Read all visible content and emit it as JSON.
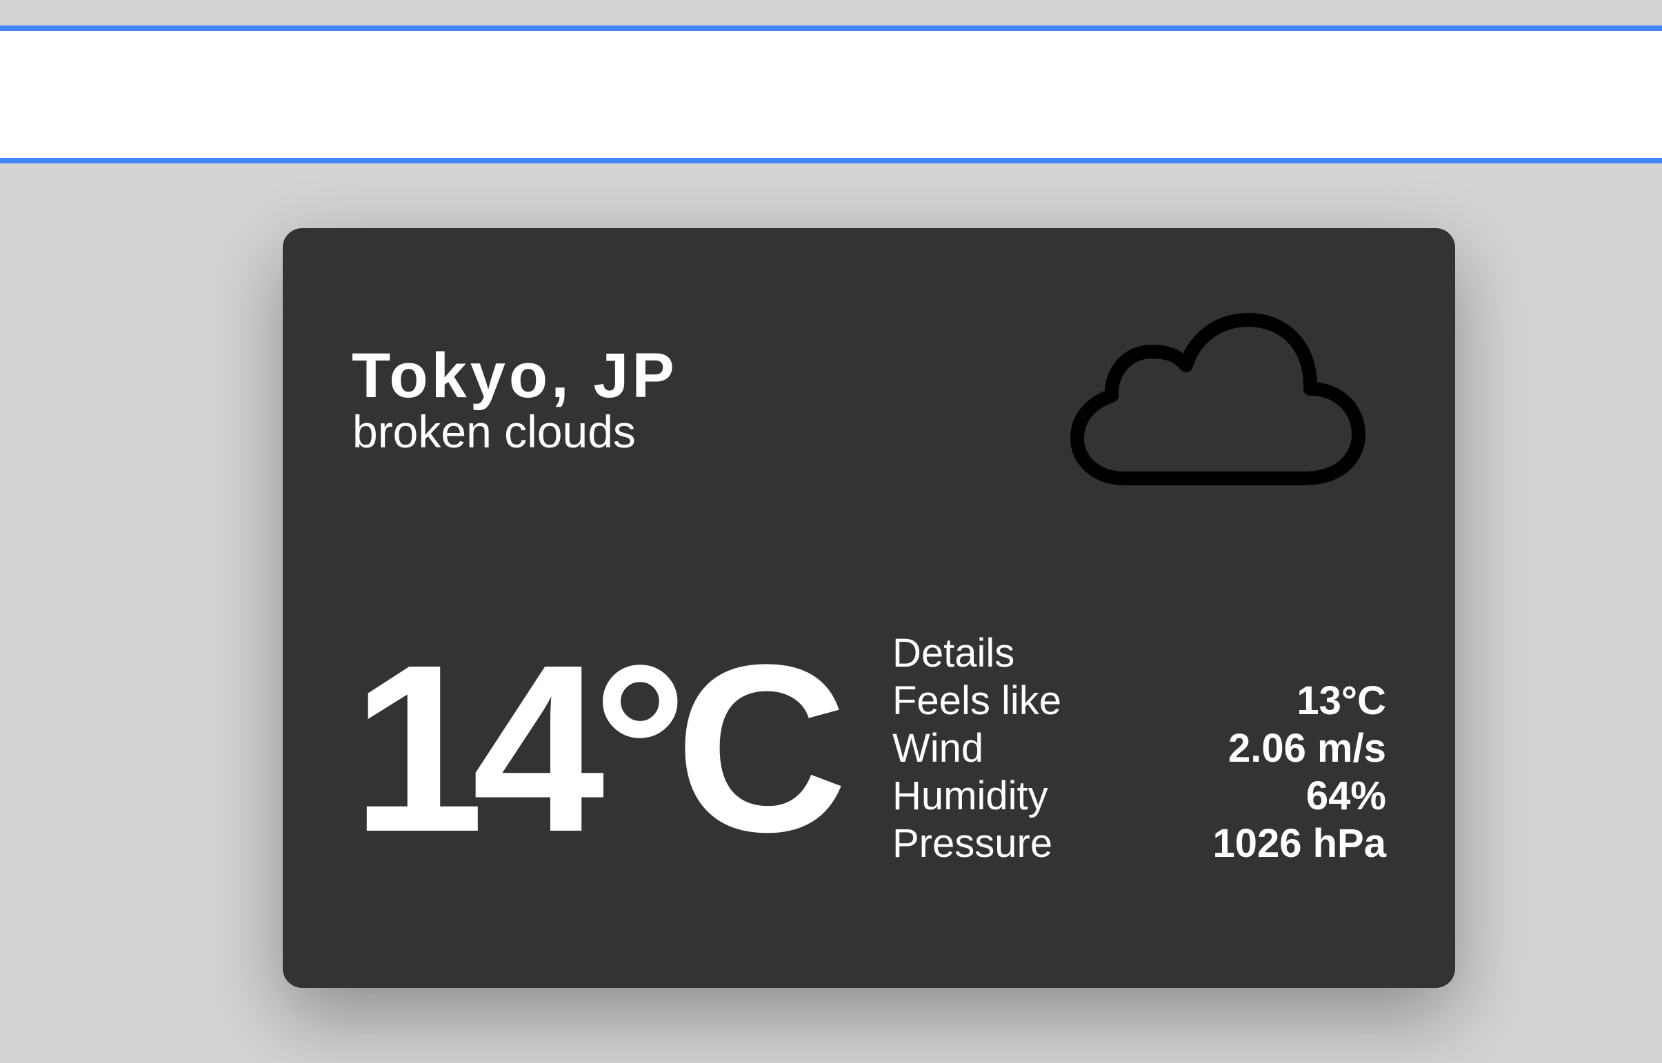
{
  "search": {
    "value": "",
    "placeholder": ""
  },
  "weather": {
    "city": "Tokyo, JP",
    "description": "broken clouds",
    "icon": "cloud-icon",
    "temperature": "14°C",
    "details_heading": "Details",
    "details": [
      {
        "label": "Feels like",
        "value": "13°C"
      },
      {
        "label": "Wind",
        "value": "2.06 m/s"
      },
      {
        "label": "Humidity",
        "value": "64%"
      },
      {
        "label": "Pressure",
        "value": "1026 hPa"
      }
    ]
  },
  "colors": {
    "background": "#d3d3d3",
    "search_border": "#4285f4",
    "card_background": "#333333",
    "text": "#ffffff",
    "icon": "#000000"
  }
}
